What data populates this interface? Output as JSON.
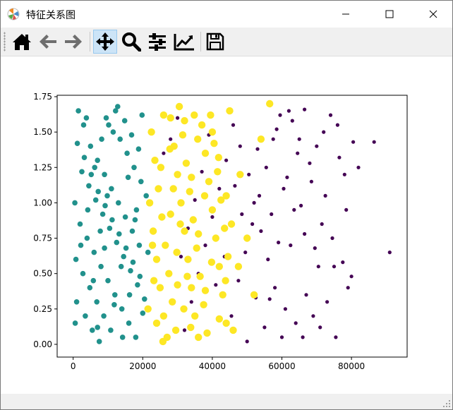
{
  "window": {
    "title": "特征关系图",
    "buttons": [
      "minimize",
      "maximize",
      "close"
    ]
  },
  "toolbar": {
    "items": [
      {
        "name": "home-button",
        "icon": "home-icon"
      },
      {
        "name": "back-button",
        "icon": "arrow-left-icon"
      },
      {
        "name": "forward-button",
        "icon": "arrow-right-icon"
      },
      {
        "name": "pan-button",
        "icon": "move-icon",
        "active": true
      },
      {
        "name": "zoom-button",
        "icon": "magnifier-icon"
      },
      {
        "name": "configure-subplots-button",
        "icon": "sliders-icon"
      },
      {
        "name": "edit-axis-button",
        "icon": "line-chart-icon"
      },
      {
        "name": "save-button",
        "icon": "floppy-disk-icon"
      }
    ]
  },
  "chart_data": {
    "type": "scatter",
    "title": "",
    "xlabel": "",
    "ylabel": "",
    "xlim": [
      -4600,
      96000
    ],
    "ylim": [
      -0.09,
      1.76
    ],
    "xticks": [
      0,
      20000,
      40000,
      60000,
      80000
    ],
    "xtick_labels": [
      "0",
      "20000",
      "40000",
      "60000",
      "80000"
    ],
    "yticks": [
      0.0,
      0.25,
      0.5,
      0.75,
      1.0,
      1.25,
      1.5,
      1.75
    ],
    "ytick_labels": [
      "0.00",
      "0.25",
      "0.50",
      "0.75",
      "1.00",
      "1.25",
      "1.50",
      "1.75"
    ],
    "grid": false,
    "legend": "none",
    "series": [
      {
        "color": "#440154",
        "marker_size": "small",
        "points": [
          [
            62000,
            1.65
          ],
          [
            66500,
            1.66
          ],
          [
            74000,
            1.62
          ],
          [
            80500,
            1.43
          ],
          [
            86500,
            1.43
          ],
          [
            91000,
            0.65
          ],
          [
            72000,
            1.5
          ],
          [
            70000,
            1.4
          ],
          [
            76000,
            1.55
          ],
          [
            65000,
            1.45
          ],
          [
            68000,
            1.28
          ],
          [
            78000,
            1.2
          ],
          [
            60500,
            1.1
          ],
          [
            63500,
            0.95
          ],
          [
            71500,
            0.85
          ],
          [
            75000,
            0.55
          ],
          [
            77500,
            0.58
          ],
          [
            79000,
            0.4
          ],
          [
            82000,
            1.25
          ],
          [
            73000,
            0.3
          ],
          [
            69000,
            0.2
          ],
          [
            66000,
            0.05
          ],
          [
            61000,
            0.25
          ],
          [
            58000,
            0.4
          ],
          [
            56000,
            0.6
          ],
          [
            54000,
            0.8
          ],
          [
            52000,
            1.0
          ],
          [
            50500,
            1.2
          ],
          [
            48000,
            1.4
          ],
          [
            46000,
            1.55
          ],
          [
            44000,
            1.3
          ],
          [
            42000,
            1.1
          ],
          [
            40000,
            0.9
          ],
          [
            38000,
            0.7
          ],
          [
            36000,
            0.5
          ],
          [
            34000,
            0.3
          ],
          [
            32000,
            0.1
          ],
          [
            30000,
            1.6
          ],
          [
            28000,
            1.45
          ],
          [
            26000,
            1.35
          ],
          [
            45500,
            0.2
          ],
          [
            47500,
            0.45
          ],
          [
            49500,
            0.65
          ],
          [
            51500,
            0.85
          ],
          [
            53500,
            1.05
          ],
          [
            55500,
            1.25
          ],
          [
            57500,
            1.45
          ],
          [
            59500,
            1.62
          ],
          [
            64000,
            0.15
          ],
          [
            67000,
            0.35
          ],
          [
            70500,
            0.55
          ],
          [
            74500,
            0.75
          ],
          [
            78500,
            0.95
          ],
          [
            80000,
            0.48
          ],
          [
            72500,
            1.05
          ],
          [
            68500,
            1.15
          ],
          [
            64500,
            1.35
          ],
          [
            62500,
            0.7
          ],
          [
            60000,
            0.05
          ],
          [
            58500,
            1.52
          ],
          [
            55000,
            0.12
          ],
          [
            52500,
            0.33
          ],
          [
            50000,
            0.02
          ],
          [
            48500,
            0.92
          ],
          [
            46500,
            1.12
          ],
          [
            43500,
            0.62
          ],
          [
            41000,
            0.42
          ],
          [
            39000,
            1.48
          ],
          [
            37000,
            1.22
          ],
          [
            35000,
            1.02
          ],
          [
            33000,
            0.82
          ],
          [
            31000,
            0.62
          ],
          [
            76500,
            1.32
          ],
          [
            71000,
            0.12
          ],
          [
            66500,
            0.78
          ],
          [
            63000,
            1.58
          ],
          [
            57000,
            0.92
          ],
          [
            53000,
            1.38
          ],
          [
            75500,
            0.05
          ],
          [
            69500,
            0.68
          ],
          [
            65500,
            0.98
          ],
          [
            61500,
            1.18
          ],
          [
            59000,
            0.72
          ],
          [
            56500,
            0.32
          ]
        ]
      },
      {
        "color": "#21918c",
        "marker_size": "medium",
        "points": [
          [
            1500,
            1.65
          ],
          [
            3000,
            1.55
          ],
          [
            5000,
            1.4
          ],
          [
            7000,
            1.3
          ],
          [
            9000,
            1.2
          ],
          [
            11000,
            1.1
          ],
          [
            13000,
            1.0
          ],
          [
            15000,
            0.9
          ],
          [
            17000,
            0.8
          ],
          [
            19000,
            0.7
          ],
          [
            500,
            1.0
          ],
          [
            2000,
            0.85
          ],
          [
            4000,
            0.75
          ],
          [
            6000,
            0.65
          ],
          [
            8000,
            0.55
          ],
          [
            10000,
            0.45
          ],
          [
            12000,
            0.35
          ],
          [
            14000,
            0.25
          ],
          [
            16000,
            0.15
          ],
          [
            18000,
            0.05
          ],
          [
            1000,
            0.3
          ],
          [
            3500,
            0.2
          ],
          [
            5500,
            0.1
          ],
          [
            7500,
            0.02
          ],
          [
            9500,
            1.6
          ],
          [
            11500,
            1.5
          ],
          [
            13500,
            1.45
          ],
          [
            15500,
            1.35
          ],
          [
            17500,
            1.25
          ],
          [
            19500,
            1.15
          ],
          [
            2500,
            1.22
          ],
          [
            4500,
            1.12
          ],
          [
            6500,
            1.02
          ],
          [
            8500,
            0.92
          ],
          [
            10500,
            0.82
          ],
          [
            12500,
            0.72
          ],
          [
            14500,
            0.62
          ],
          [
            16500,
            0.52
          ],
          [
            18500,
            0.42
          ],
          [
            20500,
            0.32
          ],
          [
            800,
            0.6
          ],
          [
            2800,
            0.5
          ],
          [
            4800,
            0.4
          ],
          [
            6800,
            0.3
          ],
          [
            8800,
            0.2
          ],
          [
            10800,
            0.1
          ],
          [
            12800,
            1.68
          ],
          [
            14800,
            1.58
          ],
          [
            16800,
            1.48
          ],
          [
            18800,
            1.38
          ],
          [
            1200,
            1.42
          ],
          [
            3200,
            1.32
          ],
          [
            5200,
            1.2
          ],
          [
            7200,
            1.08
          ],
          [
            9200,
            0.98
          ],
          [
            11200,
            0.88
          ],
          [
            13200,
            0.78
          ],
          [
            15200,
            0.68
          ],
          [
            17200,
            0.58
          ],
          [
            19200,
            0.48
          ],
          [
            21000,
            1.05
          ],
          [
            21500,
            0.65
          ],
          [
            20000,
            0.22
          ],
          [
            600,
            0.15
          ],
          [
            2200,
            0.7
          ],
          [
            4200,
            0.95
          ],
          [
            6200,
            1.25
          ],
          [
            8200,
            1.45
          ],
          [
            10200,
            1.55
          ],
          [
            12200,
            1.65
          ],
          [
            14200,
            0.05
          ],
          [
            16200,
            0.35
          ],
          [
            18200,
            0.95
          ],
          [
            3800,
            1.6
          ],
          [
            5800,
            0.45
          ],
          [
            7800,
            0.8
          ],
          [
            9800,
            1.05
          ],
          [
            11800,
            0.28
          ],
          [
            13800,
            0.55
          ],
          [
            15800,
            1.18
          ],
          [
            17800,
            0.88
          ],
          [
            19800,
            1.62
          ],
          [
            7000,
            0.12
          ],
          [
            9000,
            0.68
          ]
        ]
      },
      {
        "color": "#fde725",
        "marker_size": "large",
        "points": [
          [
            22000,
            1.0
          ],
          [
            23000,
            0.8
          ],
          [
            24000,
            0.6
          ],
          [
            25000,
            0.4
          ],
          [
            26000,
            0.2
          ],
          [
            27000,
            0.05
          ],
          [
            28000,
            1.6
          ],
          [
            29000,
            1.4
          ],
          [
            30000,
            1.2
          ],
          [
            31000,
            1.0
          ],
          [
            32000,
            0.8
          ],
          [
            33000,
            0.6
          ],
          [
            34000,
            0.4
          ],
          [
            35000,
            0.2
          ],
          [
            36000,
            0.05
          ],
          [
            37000,
            1.55
          ],
          [
            38000,
            1.35
          ],
          [
            39000,
            1.15
          ],
          [
            40000,
            0.95
          ],
          [
            41000,
            0.75
          ],
          [
            42000,
            0.55
          ],
          [
            43000,
            0.35
          ],
          [
            44000,
            0.15
          ],
          [
            45000,
            1.65
          ],
          [
            22500,
            1.5
          ],
          [
            23500,
            1.3
          ],
          [
            24500,
            1.1
          ],
          [
            25500,
            0.9
          ],
          [
            26500,
            0.7
          ],
          [
            27500,
            0.5
          ],
          [
            28500,
            0.3
          ],
          [
            29500,
            0.1
          ],
          [
            30500,
            1.68
          ],
          [
            31500,
            1.48
          ],
          [
            32500,
            1.28
          ],
          [
            33500,
            1.08
          ],
          [
            34500,
            0.88
          ],
          [
            35500,
            0.68
          ],
          [
            36500,
            0.48
          ],
          [
            37500,
            0.28
          ],
          [
            38500,
            0.08
          ],
          [
            39500,
            1.62
          ],
          [
            40500,
            1.42
          ],
          [
            41500,
            1.22
          ],
          [
            42500,
            1.02
          ],
          [
            43500,
            0.82
          ],
          [
            44500,
            0.62
          ],
          [
            21500,
            0.25
          ],
          [
            46000,
            0.1
          ],
          [
            48000,
            1.2
          ],
          [
            50000,
            0.75
          ],
          [
            52000,
            0.35
          ],
          [
            54000,
            1.45
          ],
          [
            56500,
            1.7
          ],
          [
            24000,
            0.15
          ],
          [
            26000,
            1.62
          ],
          [
            28000,
            0.92
          ],
          [
            30000,
            0.42
          ],
          [
            32000,
            1.58
          ],
          [
            34000,
            1.18
          ],
          [
            36000,
            0.78
          ],
          [
            38000,
            0.38
          ],
          [
            40000,
            1.5
          ],
          [
            42000,
            0.18
          ],
          [
            44000,
            1.05
          ],
          [
            22800,
            0.7
          ],
          [
            25200,
            1.25
          ],
          [
            27800,
            1.38
          ],
          [
            29800,
            0.65
          ],
          [
            31800,
            0.25
          ],
          [
            33800,
            0.12
          ],
          [
            35800,
            1.45
          ],
          [
            37800,
            1.05
          ],
          [
            39800,
            0.58
          ],
          [
            41800,
            1.32
          ],
          [
            43800,
            0.45
          ],
          [
            45500,
            0.85
          ],
          [
            47500,
            0.55
          ],
          [
            23200,
            0.45
          ],
          [
            25800,
            0.02
          ],
          [
            28800,
            1.1
          ],
          [
            30800,
            0.85
          ],
          [
            32800,
            0.48
          ],
          [
            34800,
            1.62
          ]
        ]
      }
    ]
  }
}
